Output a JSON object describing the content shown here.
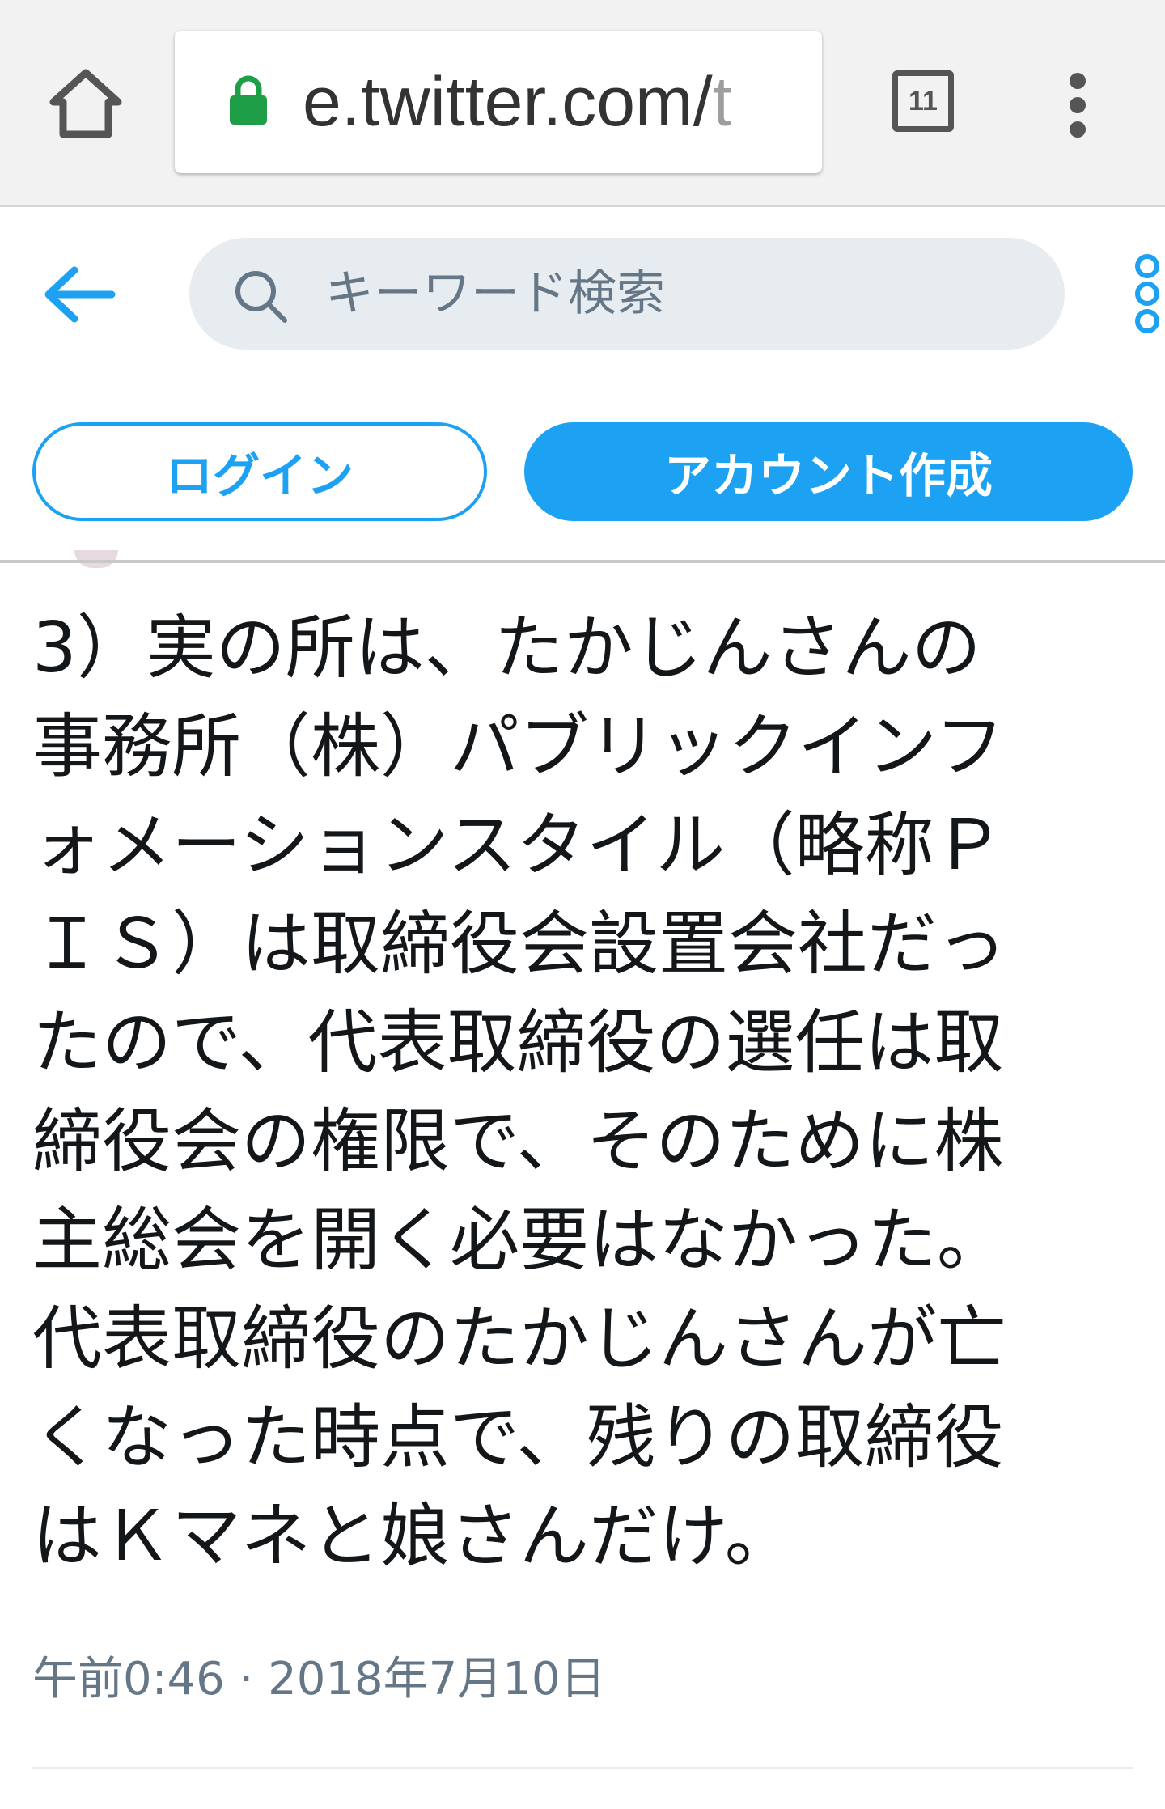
{
  "browser": {
    "url_prefix": "e.twitter.com/",
    "url_overflow": "t",
    "tab_count": "11",
    "icons": [
      "home-icon",
      "lock-icon",
      "tab-switcher-icon",
      "overflow-menu-icon"
    ],
    "colors": {
      "lock": "#1e9e47",
      "chrome_bg": "#f2f2f2"
    }
  },
  "header": {
    "search_placeholder": "キーワード検索",
    "icons": [
      "back-arrow-icon",
      "search-icon",
      "more-icon"
    ],
    "accent": "#1da1f2"
  },
  "auth": {
    "login_label": "ログイン",
    "signup_label": "アカウント作成"
  },
  "tweet": {
    "lines": [
      "3）実の所は、たかじんさんの",
      "事務所（株）パブリックインフ",
      "ォメーションスタイル（略称Ｐ",
      "ＩＳ）は取締役会設置会社だっ",
      "たので、代表取締役の選任は取",
      "締役会の権限で、そのために株",
      "主総会を開く必要はなかった。",
      "代表取締役のたかじんさんが亡",
      "くなった時点で、残りの取締役",
      "はＫマネと娘さんだけ。"
    ],
    "timestamp": "午前0:46 · 2018年7月10日"
  }
}
